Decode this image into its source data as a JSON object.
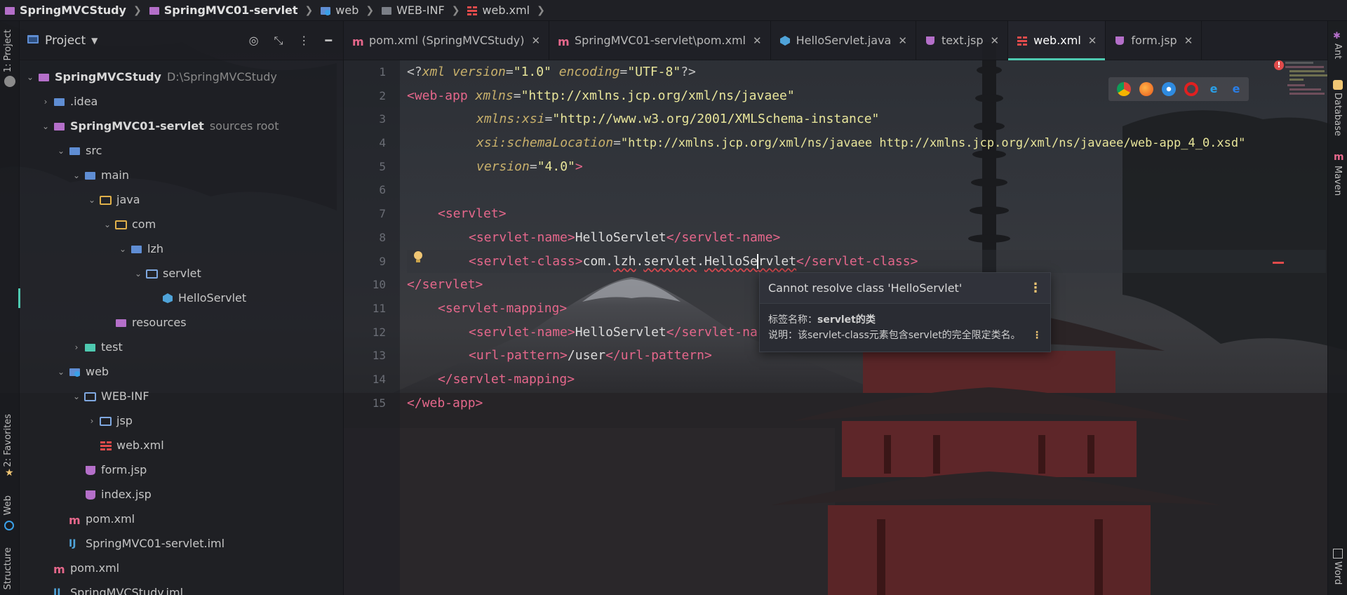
{
  "breadcrumb": {
    "items": [
      "SpringMVCStudy",
      "SpringMVC01-servlet",
      "web",
      "WEB-INF",
      "web.xml"
    ]
  },
  "left_strip": {
    "project": "1: Project",
    "favorites": "2: Favorites",
    "web": "Web",
    "structure": "Structure"
  },
  "right_strip": {
    "ant": "Ant",
    "database": "Database",
    "maven": "Maven",
    "word": "Word"
  },
  "project_panel": {
    "title": "Project",
    "tree": [
      {
        "label": "SpringMVCStudy",
        "hint": "D:\\SpringMVCStudy"
      },
      {
        "label": ".idea",
        "hint": ""
      },
      {
        "label": "SpringMVC01-servlet",
        "hint": "sources root"
      },
      {
        "label": "src",
        "hint": ""
      },
      {
        "label": "main",
        "hint": ""
      },
      {
        "label": "java",
        "hint": ""
      },
      {
        "label": "com",
        "hint": ""
      },
      {
        "label": "lzh",
        "hint": ""
      },
      {
        "label": "servlet",
        "hint": ""
      },
      {
        "label": "HelloServlet",
        "hint": ""
      },
      {
        "label": "resources",
        "hint": ""
      },
      {
        "label": "test",
        "hint": ""
      },
      {
        "label": "web",
        "hint": ""
      },
      {
        "label": "WEB-INF",
        "hint": ""
      },
      {
        "label": "jsp",
        "hint": ""
      },
      {
        "label": "web.xml",
        "hint": ""
      },
      {
        "label": "form.jsp",
        "hint": ""
      },
      {
        "label": "index.jsp",
        "hint": ""
      },
      {
        "label": "pom.xml",
        "hint": ""
      },
      {
        "label": "SpringMVC01-servlet.iml",
        "hint": ""
      },
      {
        "label": "pom.xml",
        "hint": ""
      },
      {
        "label": "SpringMVCStudy.iml",
        "hint": ""
      }
    ]
  },
  "tabs": [
    {
      "label": "pom.xml (SpringMVCStudy)",
      "icon": "maven-icon",
      "active": false
    },
    {
      "label": "SpringMVC01-servlet\\pom.xml",
      "icon": "maven-icon",
      "active": false
    },
    {
      "label": "HelloServlet.java",
      "icon": "java-class-icon",
      "active": false
    },
    {
      "label": "text.jsp",
      "icon": "jsp-icon",
      "active": false
    },
    {
      "label": "web.xml",
      "icon": "xml-icon",
      "active": true
    },
    {
      "label": "form.jsp",
      "icon": "jsp-icon",
      "active": false
    }
  ],
  "editor": {
    "line_numbers": [
      "1",
      "2",
      "3",
      "4",
      "5",
      "6",
      "7",
      "8",
      "9",
      "10",
      "11",
      "12",
      "13",
      "14",
      "15"
    ],
    "lines": {
      "l1": {
        "a": "<?",
        "b": "xml version",
        "c": "=",
        "d": "\"1.0\"",
        "e": " encoding",
        "f": "=",
        "g": "\"UTF-8\"",
        "h": "?>"
      },
      "l2": {
        "a": "<web-app ",
        "b": "xmlns",
        "c": "=",
        "d": "\"http://xmlns.jcp.org/xml/ns/javaee\""
      },
      "l3": {
        "a": "xmlns:xsi",
        "b": "=",
        "c": "\"http://www.w3.org/2001/XMLSchema-instance\""
      },
      "l4": {
        "a": "xsi:schemaLocation",
        "b": "=",
        "c": "\"http://xmlns.jcp.org/xml/ns/javaee http://xmlns.jcp.org/xml/ns/javaee/web-app_4_0.xsd\""
      },
      "l5": {
        "a": "version",
        "b": "=",
        "c": "\"4.0\"",
        "d": ">"
      },
      "l7": {
        "a": "<servlet>"
      },
      "l8": {
        "a": "<servlet-name>",
        "b": "HelloServlet",
        "c": "</servlet-name>"
      },
      "l9": {
        "a": "<servlet-class>",
        "b": "com.",
        "c": "lzh",
        "d": ".",
        "e": "servlet",
        "f": ".",
        "g": "HelloSe",
        "h": "rvlet",
        "i": "</servlet-class>"
      },
      "l10": {
        "a": "</servlet>"
      },
      "l11": {
        "a": "<servlet-mapping>"
      },
      "l12": {
        "a": "<servlet-name>",
        "b": "HelloServlet",
        "c": "</servlet-na"
      },
      "l13": {
        "a": "<url-pattern>",
        "b": "/user",
        "c": "</url-pattern>"
      },
      "l14": {
        "a": "</servlet-mapping>"
      },
      "l15": {
        "a": "</web-app>"
      }
    }
  },
  "popup": {
    "title": "Cannot resolve class 'HelloServlet'",
    "label_prefix": "标签名称：",
    "label_value": "servlet的类",
    "description": "说明：该servlet-class元素包含servlet的完全限定类名。"
  },
  "browsers": [
    "chrome-icon",
    "firefox-icon",
    "safari-icon",
    "opera-icon",
    "ie-icon",
    "edge-icon"
  ],
  "colors": {
    "accent": "#4ec9b0",
    "tag": "#e5678b",
    "attribute": "#c8b06b",
    "string": "#e8e59a",
    "error": "#e04b4b",
    "warning": "#f0c674"
  }
}
